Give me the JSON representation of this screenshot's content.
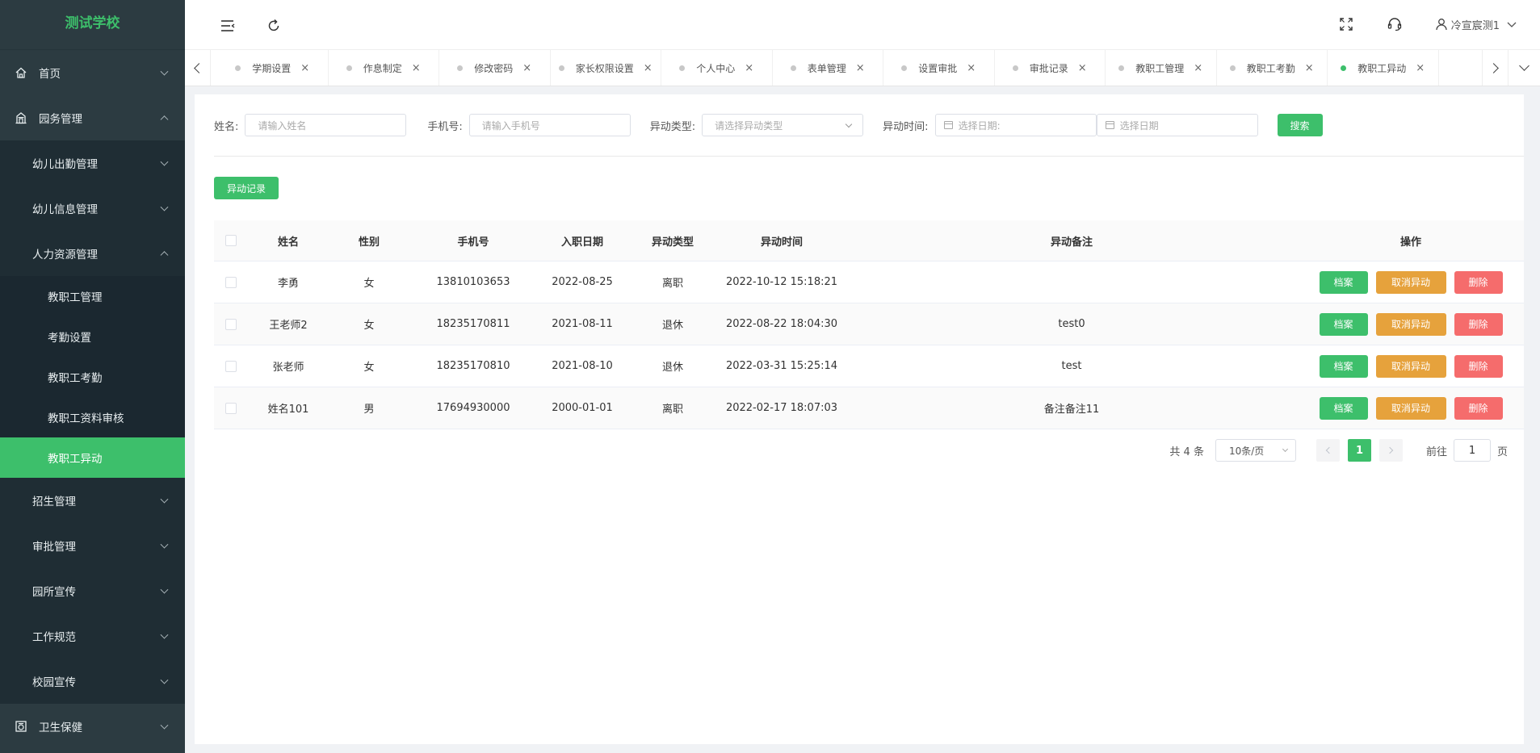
{
  "app": {
    "logo": "测试学校"
  },
  "sidebar": {
    "items": [
      {
        "label": "首页"
      },
      {
        "label": "园务管理"
      },
      {
        "label": "幼儿出勤管理"
      },
      {
        "label": "幼儿信息管理"
      },
      {
        "label": "人力资源管理"
      },
      {
        "label": "教职工管理"
      },
      {
        "label": "考勤设置"
      },
      {
        "label": "教职工考勤"
      },
      {
        "label": "教职工资料审核"
      },
      {
        "label": "教职工异动"
      },
      {
        "label": "招生管理"
      },
      {
        "label": "审批管理"
      },
      {
        "label": "园所宣传"
      },
      {
        "label": "工作规范"
      },
      {
        "label": "校园宣传"
      },
      {
        "label": "卫生保健"
      }
    ],
    "active_color": "#3dbf6b"
  },
  "header": {
    "user_name": "冷宣宸测1"
  },
  "tabs": [
    {
      "label": "学期设置"
    },
    {
      "label": "作息制定"
    },
    {
      "label": "修改密码"
    },
    {
      "label": "家长权限设置"
    },
    {
      "label": "个人中心"
    },
    {
      "label": "表单管理"
    },
    {
      "label": "设置审批"
    },
    {
      "label": "审批记录"
    },
    {
      "label": "教职工管理"
    },
    {
      "label": "教职工考勤"
    },
    {
      "label": "教职工异动"
    }
  ],
  "tab_close": "×",
  "filter": {
    "name_label": "姓名:",
    "name_placeholder": "请输入姓名",
    "phone_label": "手机号:",
    "phone_placeholder": "请输入手机号",
    "type_label": "异动类型:",
    "type_placeholder": "请选择异动类型",
    "time_label": "异动时间:",
    "start_placeholder": "选择日期:",
    "end_placeholder": "选择日期",
    "search_label": "搜索"
  },
  "record_button": "异动记录",
  "table": {
    "headers": {
      "name": "姓名",
      "sex": "性别",
      "phone": "手机号",
      "join_date": "入职日期",
      "type": "异动类型",
      "time": "异动时间",
      "note": "异动备注",
      "ops": "操作"
    },
    "rows": [
      {
        "name": "李勇",
        "sex": "女",
        "phone": "13810103653",
        "join_date": "2022-08-25",
        "type": "离职",
        "time": "2022-10-12 15:18:21",
        "note": ""
      },
      {
        "name": "王老师2",
        "sex": "女",
        "phone": "18235170811",
        "join_date": "2021-08-11",
        "type": "退休",
        "time": "2022-08-22 18:04:30",
        "note": "test0"
      },
      {
        "name": "张老师",
        "sex": "女",
        "phone": "18235170810",
        "join_date": "2021-08-10",
        "type": "退休",
        "time": "2022-03-31 15:25:14",
        "note": "test"
      },
      {
        "name": "姓名101",
        "sex": "男",
        "phone": "17694930000",
        "join_date": "2000-01-01",
        "type": "离职",
        "time": "2022-02-17 18:07:03",
        "note": "备注备注11"
      }
    ],
    "op_archive": "档案",
    "op_cancel": "取消异动",
    "op_delete": "删除"
  },
  "pagination": {
    "total": "共 4 条",
    "page_size": "10条/页",
    "current_page": "1",
    "goto_prefix": "前往",
    "goto_value": "1",
    "goto_suffix": "页"
  },
  "colors": {
    "primary": "#3dbf6b",
    "warning": "#e6a23c",
    "danger": "#f56c6c",
    "sidebar_bg": "#2c3b41"
  }
}
